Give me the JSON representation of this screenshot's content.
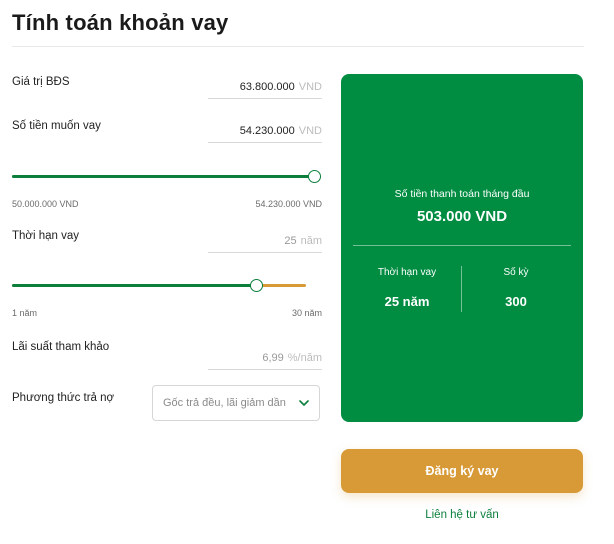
{
  "title": "Tính toán khoản vay",
  "form": {
    "property_value": {
      "label": "Giá trị BĐS",
      "value": "63.800.000",
      "unit": "VND"
    },
    "loan_amount": {
      "label": "Số tiền muốn vay",
      "value": "54.230.000",
      "unit": "VND",
      "slider": {
        "min_label": "50.000.000  VND",
        "max_label": "54.230.000  VND",
        "position_fraction": 1.0
      }
    },
    "term": {
      "label": "Thời hạn vay",
      "value": "25",
      "unit": "năm",
      "slider": {
        "min_label": "1 năm",
        "max_label": "30 năm",
        "position_fraction": 0.83
      }
    },
    "interest": {
      "label": "Lãi suất tham khảo",
      "value": "6,99",
      "unit": "%/năm"
    },
    "repayment": {
      "label": "Phương thức trả nợ",
      "selected": "Gốc trả đều, lãi giảm dần"
    }
  },
  "result": {
    "monthly_label": "Số tiền thanh toán tháng đầu",
    "monthly_value": "503.000 VND",
    "term_label": "Thời hạn vay",
    "term_value": "25 năm",
    "periods_label": "Số kỳ",
    "periods_value": "300"
  },
  "actions": {
    "register_label": "Đăng ký vay",
    "contact_label": "Liên hệ tư vấn"
  },
  "colors": {
    "green": "#008c41",
    "gold": "#d79a37"
  },
  "icons": {
    "select_chevron": "chevron-down-icon"
  }
}
